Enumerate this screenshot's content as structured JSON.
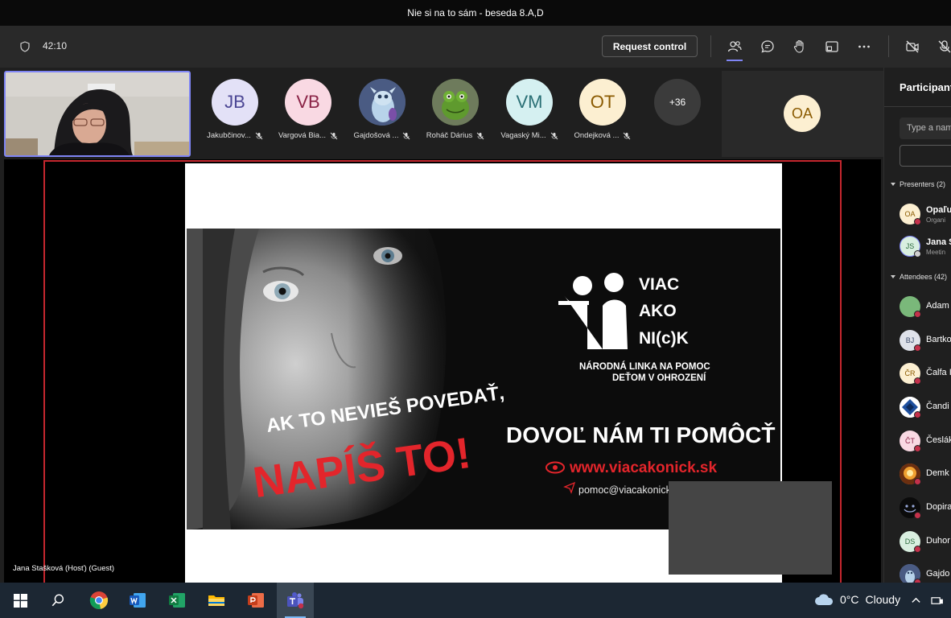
{
  "window": {
    "title": "Nie si na to sám - beseda 8.A,D"
  },
  "toolbar": {
    "timer": "42:10",
    "request_control_label": "Request control"
  },
  "gallery": {
    "participants": [
      {
        "initials": "JB",
        "name": "Jakubčinov...",
        "bg": "#e3e1f7",
        "fg": "#4b4694"
      },
      {
        "initials": "VB",
        "name": "Vargová Bia...",
        "bg": "#f9d9e3",
        "fg": "#8a2346"
      },
      {
        "initials": "",
        "name": "Gajdošová ...",
        "bg": "#6a7ba3",
        "fg": "#fff",
        "icon": "cartoon-avatar"
      },
      {
        "initials": "",
        "name": "Roháč Dárius",
        "bg": "#3a5a2a",
        "fg": "#fff",
        "icon": "frog-avatar"
      },
      {
        "initials": "VM",
        "name": "Vagaský Mi...",
        "bg": "#d5f0f1",
        "fg": "#2a6f75"
      },
      {
        "initials": "OT",
        "name": "Ondejková ...",
        "bg": "#fcefd1",
        "fg": "#8a5a00"
      }
    ],
    "more_count": "+36",
    "highlight_initials": "OA"
  },
  "share": {
    "presenter_label": "Jana Stašková (Hosť) (Guest)",
    "slide": {
      "headline_line1": "AK TO NEVIEŠ POVEDAŤ,",
      "headline_line2": "NAPÍŠ TO!",
      "logo_line1": "VIAC",
      "logo_line2": "AKO",
      "logo_line3": "NI(c)K",
      "tagline_line1": "NÁRODNÁ LINKA NA POMOC",
      "tagline_line2": "DEŤOM V OHROZENÍ",
      "cta": "DOVOĽ NÁM TI POMÔCŤ",
      "website": "www.viacakonick.sk",
      "email": "pomoc@viacakonick.gov.sk"
    }
  },
  "sidebar": {
    "title": "Participants",
    "search_placeholder": "Type a name",
    "presenters_header": "Presenters (2)",
    "attendees_header": "Attendees (42)",
    "presenters": [
      {
        "initials": "OA",
        "name": "Opaľu",
        "role": "Organi",
        "bg": "#fcefd1",
        "fg": "#8a5a00"
      },
      {
        "initials": "JS",
        "name": "Jana S",
        "role": "Meetin",
        "bg": "#d9efe0",
        "fg": "#2b6a3c"
      }
    ],
    "attendees": [
      {
        "initials": "",
        "name": "Adam",
        "bg": "#7ab87a",
        "fg": "#fff"
      },
      {
        "initials": "BJ",
        "name": "Bartko",
        "bg": "#dfe2ea",
        "fg": "#3a4a6a"
      },
      {
        "initials": "ČR",
        "name": "Čalfa I",
        "bg": "#fcefd1",
        "fg": "#8a5a00"
      },
      {
        "initials": "",
        "name": "Čandi",
        "bg": "#2b5fb8",
        "fg": "#fff"
      },
      {
        "initials": "ČT",
        "name": "Česlák",
        "bg": "#f9d9e3",
        "fg": "#8a2346"
      },
      {
        "initials": "",
        "name": "Demk",
        "bg": "#e07030",
        "fg": "#fff"
      },
      {
        "initials": "",
        "name": "Dopira",
        "bg": "#111111",
        "fg": "#fff"
      },
      {
        "initials": "DS",
        "name": "Duhor",
        "bg": "#d9efe0",
        "fg": "#2b6a3c"
      },
      {
        "initials": "",
        "name": "Gajdo",
        "bg": "#6a7ba3",
        "fg": "#fff"
      }
    ]
  },
  "taskbar": {
    "weather_temp": "0°C",
    "weather_desc": "Cloudy"
  }
}
